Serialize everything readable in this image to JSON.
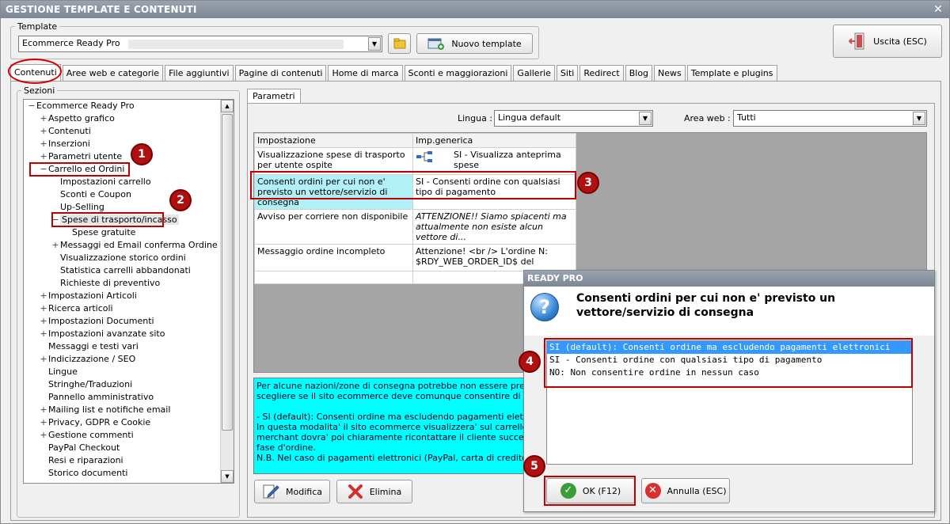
{
  "window": {
    "title": "GESTIONE TEMPLATE E CONTENUTI"
  },
  "template": {
    "group_label": "Template",
    "selected": "Ecommerce Ready Pro",
    "new_button": "Nuovo template",
    "exit_button": "Uscita (ESC)"
  },
  "tabs": [
    "Contenuti",
    "Aree web e categorie",
    "File aggiuntivi",
    "Pagine di contenuti",
    "Home di marca",
    "Sconti e maggiorazioni",
    "Gallerie",
    "Siti",
    "Redirect",
    "Blog",
    "News",
    "Template e plugins"
  ],
  "sezioni": {
    "label": "Sezioni",
    "tree": [
      {
        "label": "Ecommerce Ready Pro",
        "level": 0,
        "exp": "−"
      },
      {
        "label": "Aspetto grafico",
        "level": 1,
        "exp": "+"
      },
      {
        "label": "Contenuti",
        "level": 1,
        "exp": "+"
      },
      {
        "label": "Inserzioni",
        "level": 1,
        "exp": "+"
      },
      {
        "label": "Parametri utente",
        "level": 1,
        "exp": "+"
      },
      {
        "label": "Carrello ed Ordini",
        "level": 1,
        "exp": "−"
      },
      {
        "label": "Impostazioni carrello",
        "level": 2,
        "exp": ""
      },
      {
        "label": "Sconti e Coupon",
        "level": 2,
        "exp": ""
      },
      {
        "label": "Up-Selling",
        "level": 2,
        "exp": ""
      },
      {
        "label": "Spese di trasporto/incasso",
        "level": 2,
        "exp": "−"
      },
      {
        "label": "Spese gratuite",
        "level": 3,
        "exp": ""
      },
      {
        "label": "Messaggi ed Email conferma Ordine",
        "level": 2,
        "exp": "+"
      },
      {
        "label": "Visualizzazione storico ordini",
        "level": 2,
        "exp": ""
      },
      {
        "label": "Statistica carrelli abbandonati",
        "level": 2,
        "exp": ""
      },
      {
        "label": "Richieste di preventivo",
        "level": 2,
        "exp": ""
      },
      {
        "label": "Impostazioni Articoli",
        "level": 1,
        "exp": "+"
      },
      {
        "label": "Ricerca articoli",
        "level": 1,
        "exp": "+"
      },
      {
        "label": "Impostazioni Documenti",
        "level": 1,
        "exp": "+"
      },
      {
        "label": "Impostazioni avanzate sito",
        "level": 1,
        "exp": "+"
      },
      {
        "label": "Messaggi e testi vari",
        "level": 1,
        "exp": ""
      },
      {
        "label": "Indicizzazione / SEO",
        "level": 1,
        "exp": "+"
      },
      {
        "label": "Lingue",
        "level": 1,
        "exp": ""
      },
      {
        "label": "Stringhe/Traduzioni",
        "level": 1,
        "exp": ""
      },
      {
        "label": "Pannello amministrativo",
        "level": 1,
        "exp": ""
      },
      {
        "label": "Mailing list e notifiche email",
        "level": 1,
        "exp": "+"
      },
      {
        "label": "Privacy, GDPR e Cookie",
        "level": 1,
        "exp": "+"
      },
      {
        "label": "Gestione commenti",
        "level": 1,
        "exp": "+"
      },
      {
        "label": "PayPal Checkout",
        "level": 1,
        "exp": ""
      },
      {
        "label": "Resi e riparazioni",
        "level": 1,
        "exp": ""
      },
      {
        "label": "Storico documenti",
        "level": 1,
        "exp": ""
      }
    ]
  },
  "parametri": {
    "tab_label": "Parametri",
    "lingua_label": "Lingua :",
    "lingua_value": "Lingua default",
    "area_label": "Area web :",
    "area_value": "Tutti",
    "grid_headers": [
      "Impostazione",
      "Imp.generica"
    ],
    "grid_rows": [
      {
        "setting": "Visualizzazione spese di trasporto per utente ospite",
        "value": "SI - Visualizza anteprima spese"
      },
      {
        "setting": "Consenti ordini per cui non e' previsto un vettore/servizio di consegna",
        "value": "SI - Consenti ordine con qualsiasi tipo di pagamento"
      },
      {
        "setting": "Avviso per corriere non disponibile",
        "value": "ATTENZIONE!! Siamo spiacenti ma attualmente non esiste alcun vettore di..."
      },
      {
        "setting": "Messaggio ordine incompleto",
        "value": "Attenzione! <br /> L'ordine N: $RDY_WEB_ORDER_ID$ del"
      }
    ],
    "description_lines": [
      "Per alcune nazioni/zone di consegna potrebbe non essere previsto sul s",
      "scegliere se il sito ecommerce deve comunque consentire di inoltrare l'o",
      "",
      "- SI (default): Consenti ordine ma escludendo pagamenti  elettronici:",
      "In questa modalita' il sito ecommerce visualizzera' sul carrello il messagg",
      "merchant dovra' poi chiaramente ricontattare il cliente successivamente",
      "fase d'ordine.",
      "N.B. Nel caso di pagamenti elettronici (PayPal, carta di credito, finanzia"
    ],
    "modifica_button": "Modifica",
    "elimina_button": "Elimina"
  },
  "dialog": {
    "title": "READY PRO",
    "question": "Consenti ordini per cui non e' previsto un vettore/servizio di consegna",
    "options": [
      "SI (default): Consenti ordine ma escludendo pagamenti  elettronici",
      "SI - Consenti ordine con qualsiasi tipo di pagamento",
      "NO: Non consentire ordine in nessun caso"
    ],
    "selected_index": 0,
    "ok_button": "OK (F12)",
    "cancel_button": "Annulla (ESC)"
  },
  "annotations": [
    "1",
    "2",
    "3",
    "4",
    "5"
  ],
  "colors": {
    "annotation_red": "#c00000",
    "description_bg": "#00ffff",
    "selected_option_bg": "#3399ff",
    "grid_highlight_bg": "#b2f0f8"
  }
}
